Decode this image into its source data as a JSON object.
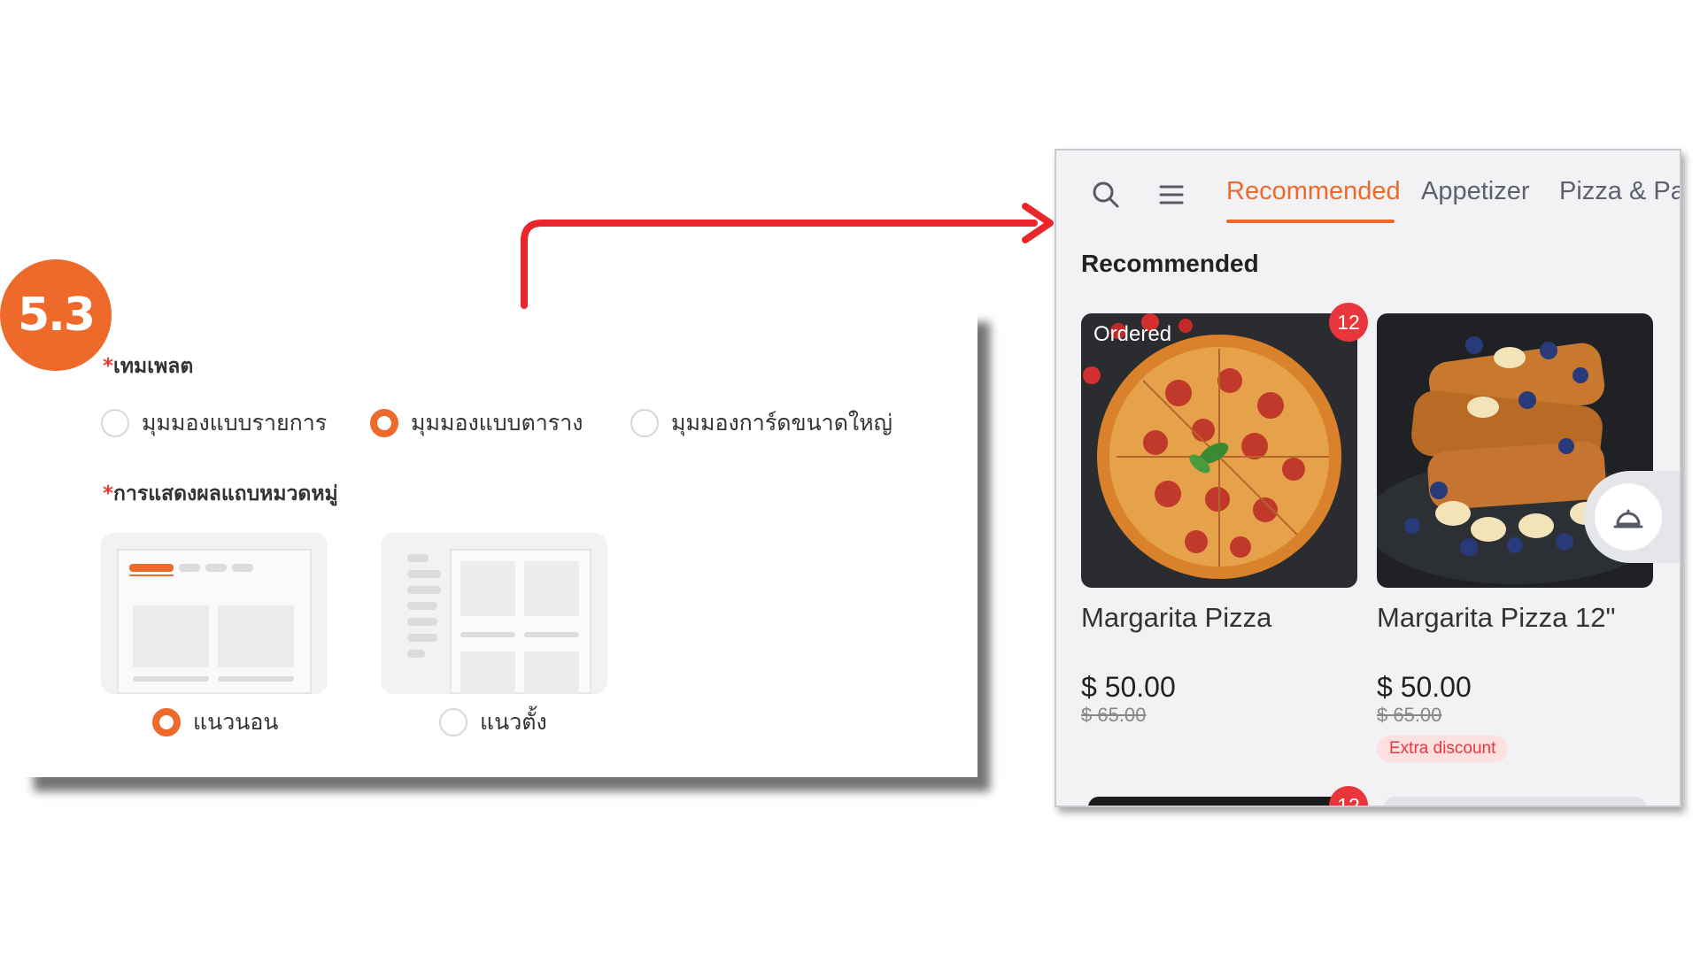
{
  "step": {
    "label": "5.3"
  },
  "settings": {
    "template": {
      "required_mark": "*",
      "label": "เทมเพลต",
      "options": [
        {
          "label": "มุมมองแบบรายการ",
          "selected": false
        },
        {
          "label": "มุมมองแบบตาราง",
          "selected": true
        },
        {
          "label": "มุมมองการ์ดขนาดใหญ่",
          "selected": false
        }
      ]
    },
    "category_bar": {
      "required_mark": "*",
      "label": "การแสดงผลแถบหมวดหมู่",
      "options": [
        {
          "label": "แนวนอน",
          "selected": true
        },
        {
          "label": "แนวตั้ง",
          "selected": false
        }
      ]
    }
  },
  "preview": {
    "tabs": [
      {
        "label": "Recommended",
        "active": true
      },
      {
        "label": "Appetizer",
        "active": false
      },
      {
        "label": "Pizza & Pa",
        "active": false
      }
    ],
    "section_title": "Recommended",
    "products": [
      {
        "name": "Margarita Pizza",
        "tag": "Ordered",
        "count": "12",
        "price": "$ 50.00",
        "old_price": "$ 65.00",
        "image": "pepperoni-pizza-image"
      },
      {
        "name": "Margarita Pizza 12\"",
        "price": "$ 50.00",
        "old_price": "$ 65.00",
        "discount": "Extra discount",
        "image": "french-toast-image"
      }
    ],
    "peek_count": "12"
  },
  "colors": {
    "accent": "#ee6a2a",
    "badge_red": "#e8363c",
    "arrow_red": "#e8262c"
  }
}
